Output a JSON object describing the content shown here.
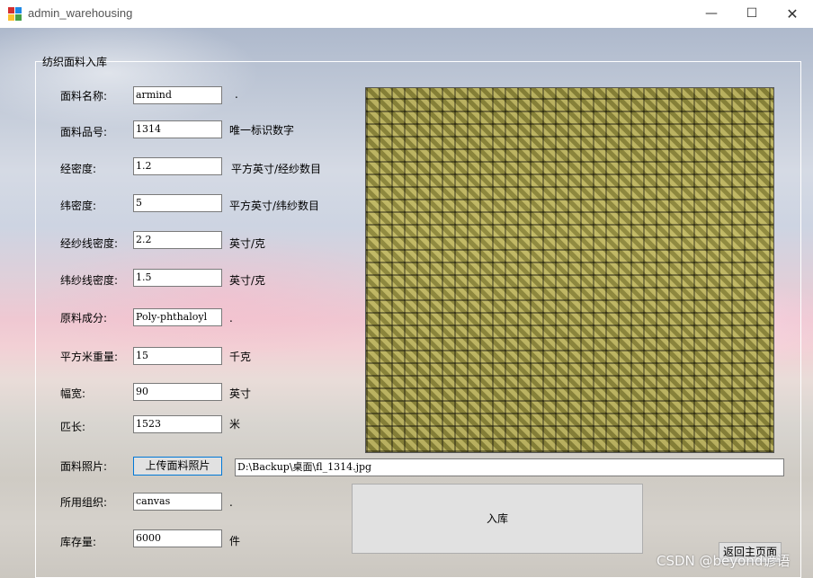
{
  "window": {
    "title": "admin_warehousing",
    "minimize_glyph": "—",
    "maximize_glyph": "☐",
    "close_glyph": "✕"
  },
  "group": {
    "title": "纺织面料入库"
  },
  "fields": {
    "name": {
      "label": "面料名称:",
      "value": "armind",
      "suffix": "."
    },
    "code": {
      "label": "面料品号:",
      "value": "1314",
      "suffix": "唯一标识数字"
    },
    "warp_density": {
      "label": "经密度:",
      "value": "1.2",
      "suffix": "平方英寸/经纱数目"
    },
    "weft_density": {
      "label": "纬密度:",
      "value": "5",
      "suffix": "平方英寸/纬纱数目"
    },
    "warp_yarn_density": {
      "label": "经纱线密度:",
      "value": "2.2",
      "suffix": "英寸/克"
    },
    "weft_yarn_density": {
      "label": "纬纱线密度:",
      "value": "1.5",
      "suffix": "英寸/克"
    },
    "material": {
      "label": "原料成分:",
      "value": "Poly-phthaloyl",
      "suffix": "."
    },
    "gsm": {
      "label": "平方米重量:",
      "value": "15",
      "suffix": "千克"
    },
    "width": {
      "label": "幅宽:",
      "value": "90",
      "suffix": "英寸"
    },
    "length": {
      "label": "匹长:",
      "value": "1523",
      "suffix": "米"
    },
    "photo": {
      "label": "面料照片:"
    },
    "weave": {
      "label": "所用组织:",
      "value": "canvas",
      "suffix": "."
    },
    "stock": {
      "label": "库存量:",
      "value": "6000",
      "suffix": "件"
    }
  },
  "buttons": {
    "upload": "上传面料照片",
    "instock": "入库",
    "back": "返回主页面"
  },
  "photo_path": "D:\\Backup\\桌面\\fl_1314.jpg",
  "watermark": "CSDN @beyond谚语",
  "colors": {
    "upload_border": "#0078d7",
    "fabric": "#a39c52"
  }
}
